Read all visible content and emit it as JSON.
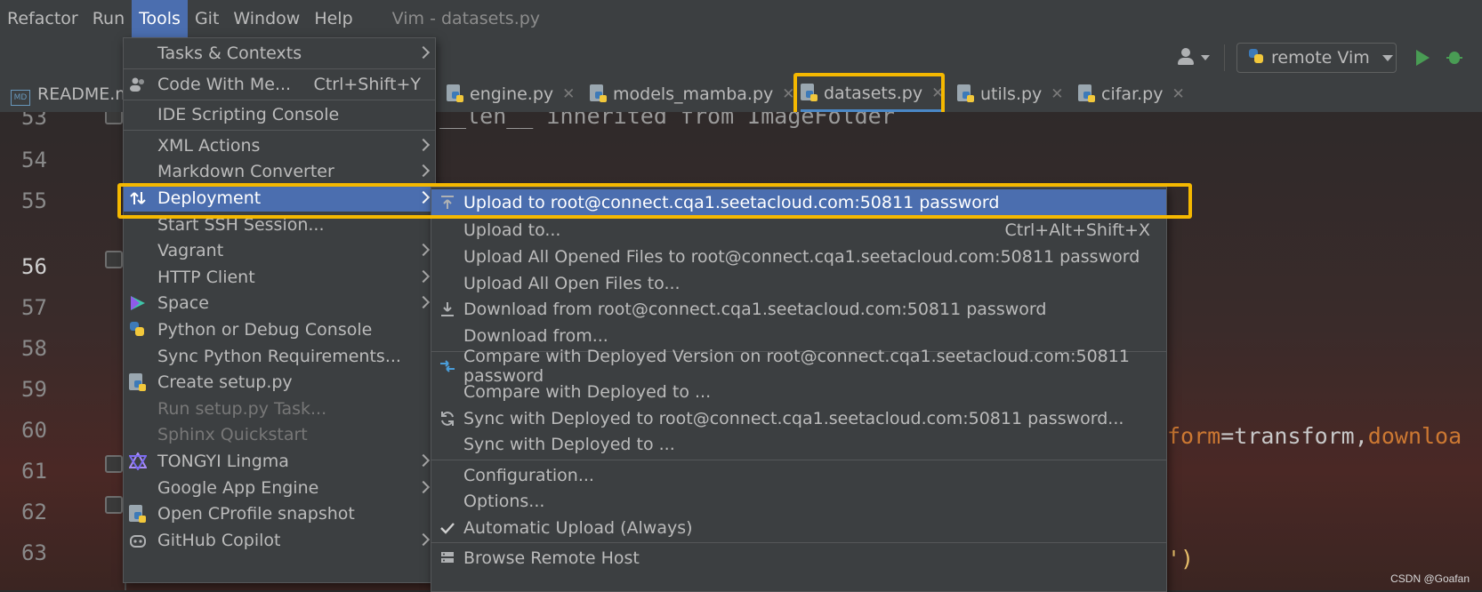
{
  "menubar": {
    "items": [
      "Refactor",
      "Run",
      "Tools",
      "Git",
      "Window",
      "Help"
    ],
    "active": "Tools",
    "window_title": "Vim - datasets.py"
  },
  "toolbar": {
    "run_config": "remote Vim",
    "icons": [
      "user-icon",
      "python-icon",
      "run-icon",
      "debug-icon"
    ]
  },
  "tabs": [
    {
      "label": "README.m",
      "icon": "markdown-icon"
    },
    {
      "label": "engine.py",
      "icon": "python-file-icon"
    },
    {
      "label": "models_mamba.py",
      "icon": "python-file-icon"
    },
    {
      "label": "datasets.py",
      "icon": "python-file-icon",
      "active": true
    },
    {
      "label": "utils.py",
      "icon": "python-file-icon"
    },
    {
      "label": "cifar.py",
      "icon": "python-file-icon"
    }
  ],
  "editor": {
    "line_numbers": [
      "53",
      "54",
      "55",
      "56",
      "57",
      "58",
      "59",
      "60",
      "61",
      "62",
      "63"
    ],
    "current_line": "56",
    "code_line_53": "__len__ inherited from ImageFolder",
    "code_line_60_a": "form",
    "code_line_60_b": "=transform,",
    "code_line_60_c": "downloa",
    "code_line_63": "')"
  },
  "tools_menu": {
    "items": [
      {
        "label": "Tasks & Contexts",
        "submenu": true
      },
      {
        "label": "Code With Me...",
        "shortcut": "Ctrl+Shift+Y",
        "icon": "people-icon"
      },
      {
        "label": "IDE Scripting Console"
      },
      {
        "label": "XML Actions",
        "submenu": true
      },
      {
        "label": "Markdown Converter",
        "submenu": true
      },
      {
        "label": "Deployment",
        "submenu": true,
        "selected": true,
        "icon": "deploy-arrows-icon"
      },
      {
        "label": "Start SSH Session..."
      },
      {
        "label": "Vagrant",
        "submenu": true
      },
      {
        "label": "HTTP Client",
        "submenu": true
      },
      {
        "label": "Space",
        "submenu": true,
        "icon": "space-icon"
      },
      {
        "label": "Python or Debug Console",
        "icon": "python-icon"
      },
      {
        "label": "Sync Python Requirements..."
      },
      {
        "label": "Create setup.py",
        "icon": "python-file-icon"
      },
      {
        "label": "Run setup.py Task...",
        "disabled": true
      },
      {
        "label": "Sphinx Quickstart",
        "disabled": true
      },
      {
        "label": "TONGYI Lingma",
        "submenu": true,
        "icon": "tongyi-icon"
      },
      {
        "label": "Google App Engine",
        "submenu": true
      },
      {
        "label": "Open CProfile snapshot",
        "icon": "python-file-icon"
      },
      {
        "label": "GitHub Copilot",
        "submenu": true,
        "icon": "copilot-icon"
      }
    ]
  },
  "deploy_menu": {
    "items": [
      {
        "label": "Upload to root@connect.cqa1.seetacloud.com:50811 password",
        "icon": "upload-icon",
        "selected": true
      },
      {
        "label": "Upload to...",
        "shortcut": "Ctrl+Alt+Shift+X"
      },
      {
        "label": "Upload All Opened Files to root@connect.cqa1.seetacloud.com:50811 password"
      },
      {
        "label": "Upload All Open Files to..."
      },
      {
        "label": "Download from root@connect.cqa1.seetacloud.com:50811 password",
        "icon": "download-icon"
      },
      {
        "label": "Download from..."
      },
      {
        "label": "Compare with Deployed Version on root@connect.cqa1.seetacloud.com:50811 password",
        "icon": "compare-icon"
      },
      {
        "label": "Compare with Deployed to ..."
      },
      {
        "label": "Sync with Deployed to root@connect.cqa1.seetacloud.com:50811 password...",
        "icon": "sync-icon"
      },
      {
        "label": "Sync with Deployed to ..."
      },
      {
        "label": "Configuration..."
      },
      {
        "label": "Options..."
      },
      {
        "label": "Automatic Upload (Always)",
        "icon": "check-icon"
      },
      {
        "label": "Browse Remote Host",
        "icon": "server-icon"
      }
    ]
  },
  "watermark": "CSDN @Goafan",
  "colors": {
    "selection": "#4b6eaf",
    "highlight_box": "#f5b800",
    "menu_bg": "#3c3f41"
  }
}
